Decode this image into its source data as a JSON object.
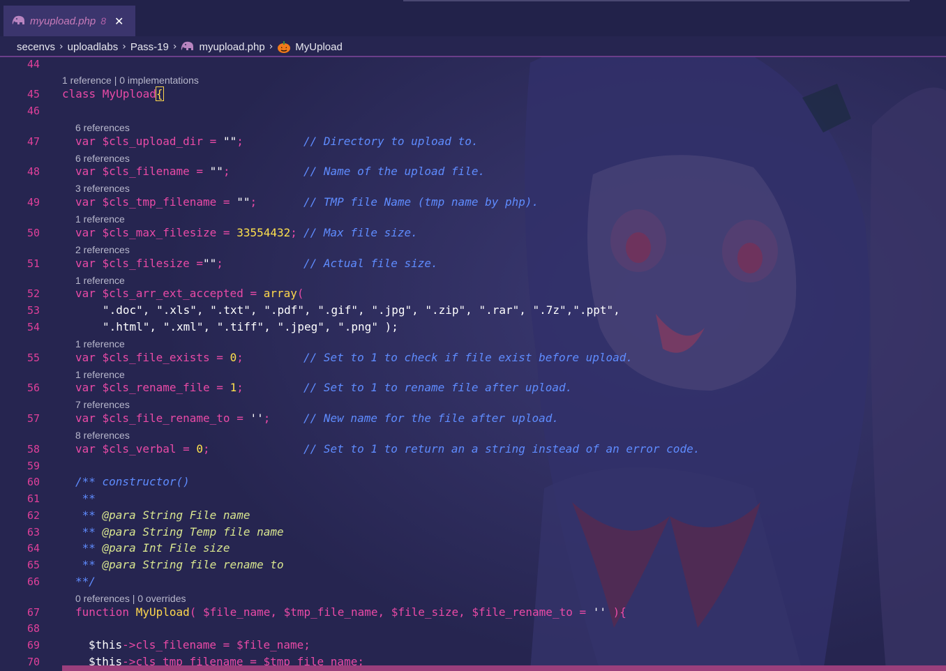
{
  "tab": {
    "name": "myupload.php",
    "problems": "8",
    "close": "✕"
  },
  "breadcrumb": [
    "secenvs",
    "uploadlabs",
    "Pass-19",
    "myupload.php",
    "MyUpload"
  ],
  "lenses": {
    "class": "1 reference | 0 implementations",
    "upload_dir": "6 references",
    "filename": "6 references",
    "tmp_filename": "3 references",
    "max_filesize": "1 reference",
    "filesize": "2 references",
    "ext_accepted": "1 reference",
    "file_exists": "1 reference",
    "rename_file": "1 reference",
    "file_rename_to": "7 references",
    "verbal": "8 references",
    "constructor": "0 references | 0 overrides"
  },
  "lines": {
    "l44": "44",
    "l45": "45",
    "l46": "46",
    "l47": "47",
    "l48": "48",
    "l49": "49",
    "l50": "50",
    "l51": "51",
    "l52": "52",
    "l53": "53",
    "l54": "54",
    "l55": "55",
    "l56": "56",
    "l57": "57",
    "l58": "58",
    "l59": "59",
    "l60": "60",
    "l61": "61",
    "l62": "62",
    "l63": "63",
    "l64": "64",
    "l65": "65",
    "l66": "66",
    "l67": "67",
    "l68": "68",
    "l69": "69",
    "l70": "70"
  },
  "code": {
    "c45_kw": "class ",
    "c45_name": "MyUpload",
    "c45_br": "{",
    "c47_kw": "var ",
    "c47_var": "$cls_upload_dir",
    "c47_op": " = ",
    "c47_str": "\"\"",
    "c47_semi": ";",
    "c47_cmt": "// Directory to upload to.",
    "c48_kw": "var ",
    "c48_var": "$cls_filename",
    "c48_op": " = ",
    "c48_str": "\"\"",
    "c48_semi": ";",
    "c48_cmt": "// Name of the upload file.",
    "c49_kw": "var ",
    "c49_var": "$cls_tmp_filename",
    "c49_op": " = ",
    "c49_str": "\"\"",
    "c49_semi": ";",
    "c49_cmt": "// TMP file Name (tmp name by php).",
    "c50_kw": "var ",
    "c50_var": "$cls_max_filesize",
    "c50_op": " = ",
    "c50_num": "33554432",
    "c50_semi": ";",
    "c50_cmt": "// Max file size.",
    "c51_kw": "var ",
    "c51_var": "$cls_filesize",
    "c51_op": " =",
    "c51_str": "\"\"",
    "c51_semi": ";",
    "c51_cmt": "// Actual file size.",
    "c52_kw": "var ",
    "c52_var": "$cls_arr_ext_accepted",
    "c52_op": " = ",
    "c52_fn": "array",
    "c52_br": "(",
    "c53": "\".doc\", \".xls\", \".txt\", \".pdf\", \".gif\", \".jpg\", \".zip\", \".rar\", \".7z\",\".ppt\",",
    "c54": "\".html\", \".xml\", \".tiff\", \".jpeg\", \".png\" );",
    "c55_kw": "var ",
    "c55_var": "$cls_file_exists",
    "c55_op": " = ",
    "c55_num": "0",
    "c55_semi": ";",
    "c55_cmt": "// Set to 1 to check if file exist before upload.",
    "c56_kw": "var ",
    "c56_var": "$cls_rename_file",
    "c56_op": " = ",
    "c56_num": "1",
    "c56_semi": ";",
    "c56_cmt": "// Set to 1 to rename file after upload.",
    "c57_kw": "var ",
    "c57_var": "$cls_file_rename_to",
    "c57_op": " = ",
    "c57_str": "''",
    "c57_semi": ";",
    "c57_cmt": "// New name for the file after upload.",
    "c58_kw": "var ",
    "c58_var": "$cls_verbal",
    "c58_op": " = ",
    "c58_num": "0",
    "c58_semi": ";",
    "c58_cmt": "// Set to 1 to return an a string instead of an error code.",
    "c60_a": "/** ",
    "c60_b": "constructor()",
    "c61": " **",
    "c62_a": " ** ",
    "c62_b": "@para String File name",
    "c63_a": " ** ",
    "c63_b": "@para String Temp file name",
    "c64_a": " ** ",
    "c64_b": "@para Int File size",
    "c65_a": " ** ",
    "c65_b": "@para String file rename to",
    "c66": "**/",
    "c67_kw": "function ",
    "c67_name": "MyUpload",
    "c67_rest": "( $file_name, $tmp_file_name, $file_size, $file_rename_to = ",
    "c67_str": "''",
    "c67_end": " ){",
    "c69_this": "$this",
    "c69_arrow": "->",
    "c69_prop": "cls_filename",
    "c69_op": " = ",
    "c69_val": "$file_name",
    "c69_semi": ";",
    "c70_this": "$this",
    "c70_arrow": "->",
    "c70_prop": "cls_tmp_filename",
    "c70_op": " = ",
    "c70_val": "$tmp_file_name",
    "c70_semi": ";"
  },
  "colors": {
    "background": "#262550",
    "keyword": "#e94aa6",
    "string": "#ffffff",
    "number": "#ffe14d",
    "comment": "#5f8cff",
    "docblock": "#d8e58f",
    "line_number": "#e0409a"
  },
  "icons": {
    "php_file": "elephant-icon",
    "class_symbol": "pumpkin-icon"
  }
}
